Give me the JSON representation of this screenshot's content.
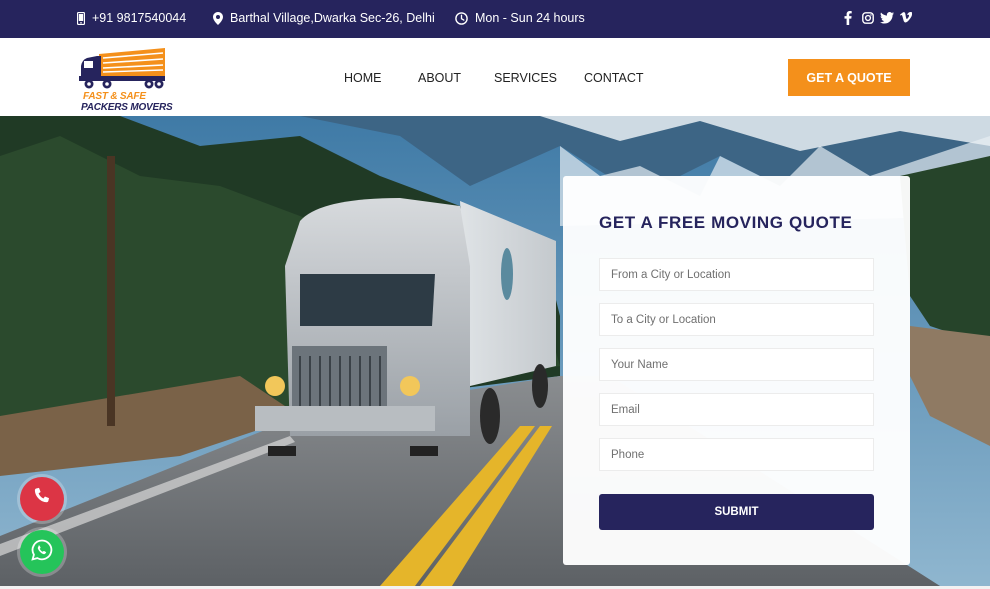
{
  "topbar": {
    "phone": "+91 9817540044",
    "address": "Barthal Village,Dwarka Sec-26, Delhi",
    "hours": "Mon - Sun 24 hours",
    "social_icons": [
      "facebook-icon",
      "instagram-icon",
      "twitter-icon",
      "vimeo-icon"
    ]
  },
  "header": {
    "logo_line1": "FAST & SAFE",
    "logo_line2": "PACKERS MOVERS",
    "nav": [
      "HOME",
      "ABOUT",
      "SERVICES",
      "CONTACT"
    ],
    "cta": "GET A QUOTE"
  },
  "form": {
    "title": "GET A FREE MOVING QUOTE",
    "from_placeholder": "From a City or Location",
    "to_placeholder": "To a City or Location",
    "name_placeholder": "Your Name",
    "email_placeholder": "Email",
    "phone_placeholder": "Phone",
    "submit": "SUBMIT"
  },
  "floating": {
    "call_icon": "phone-icon",
    "whatsapp_icon": "whatsapp-icon"
  },
  "colors": {
    "primary": "#26245d",
    "accent": "#f4901b",
    "call": "#dc3545",
    "whatsapp": "#25c45a"
  }
}
